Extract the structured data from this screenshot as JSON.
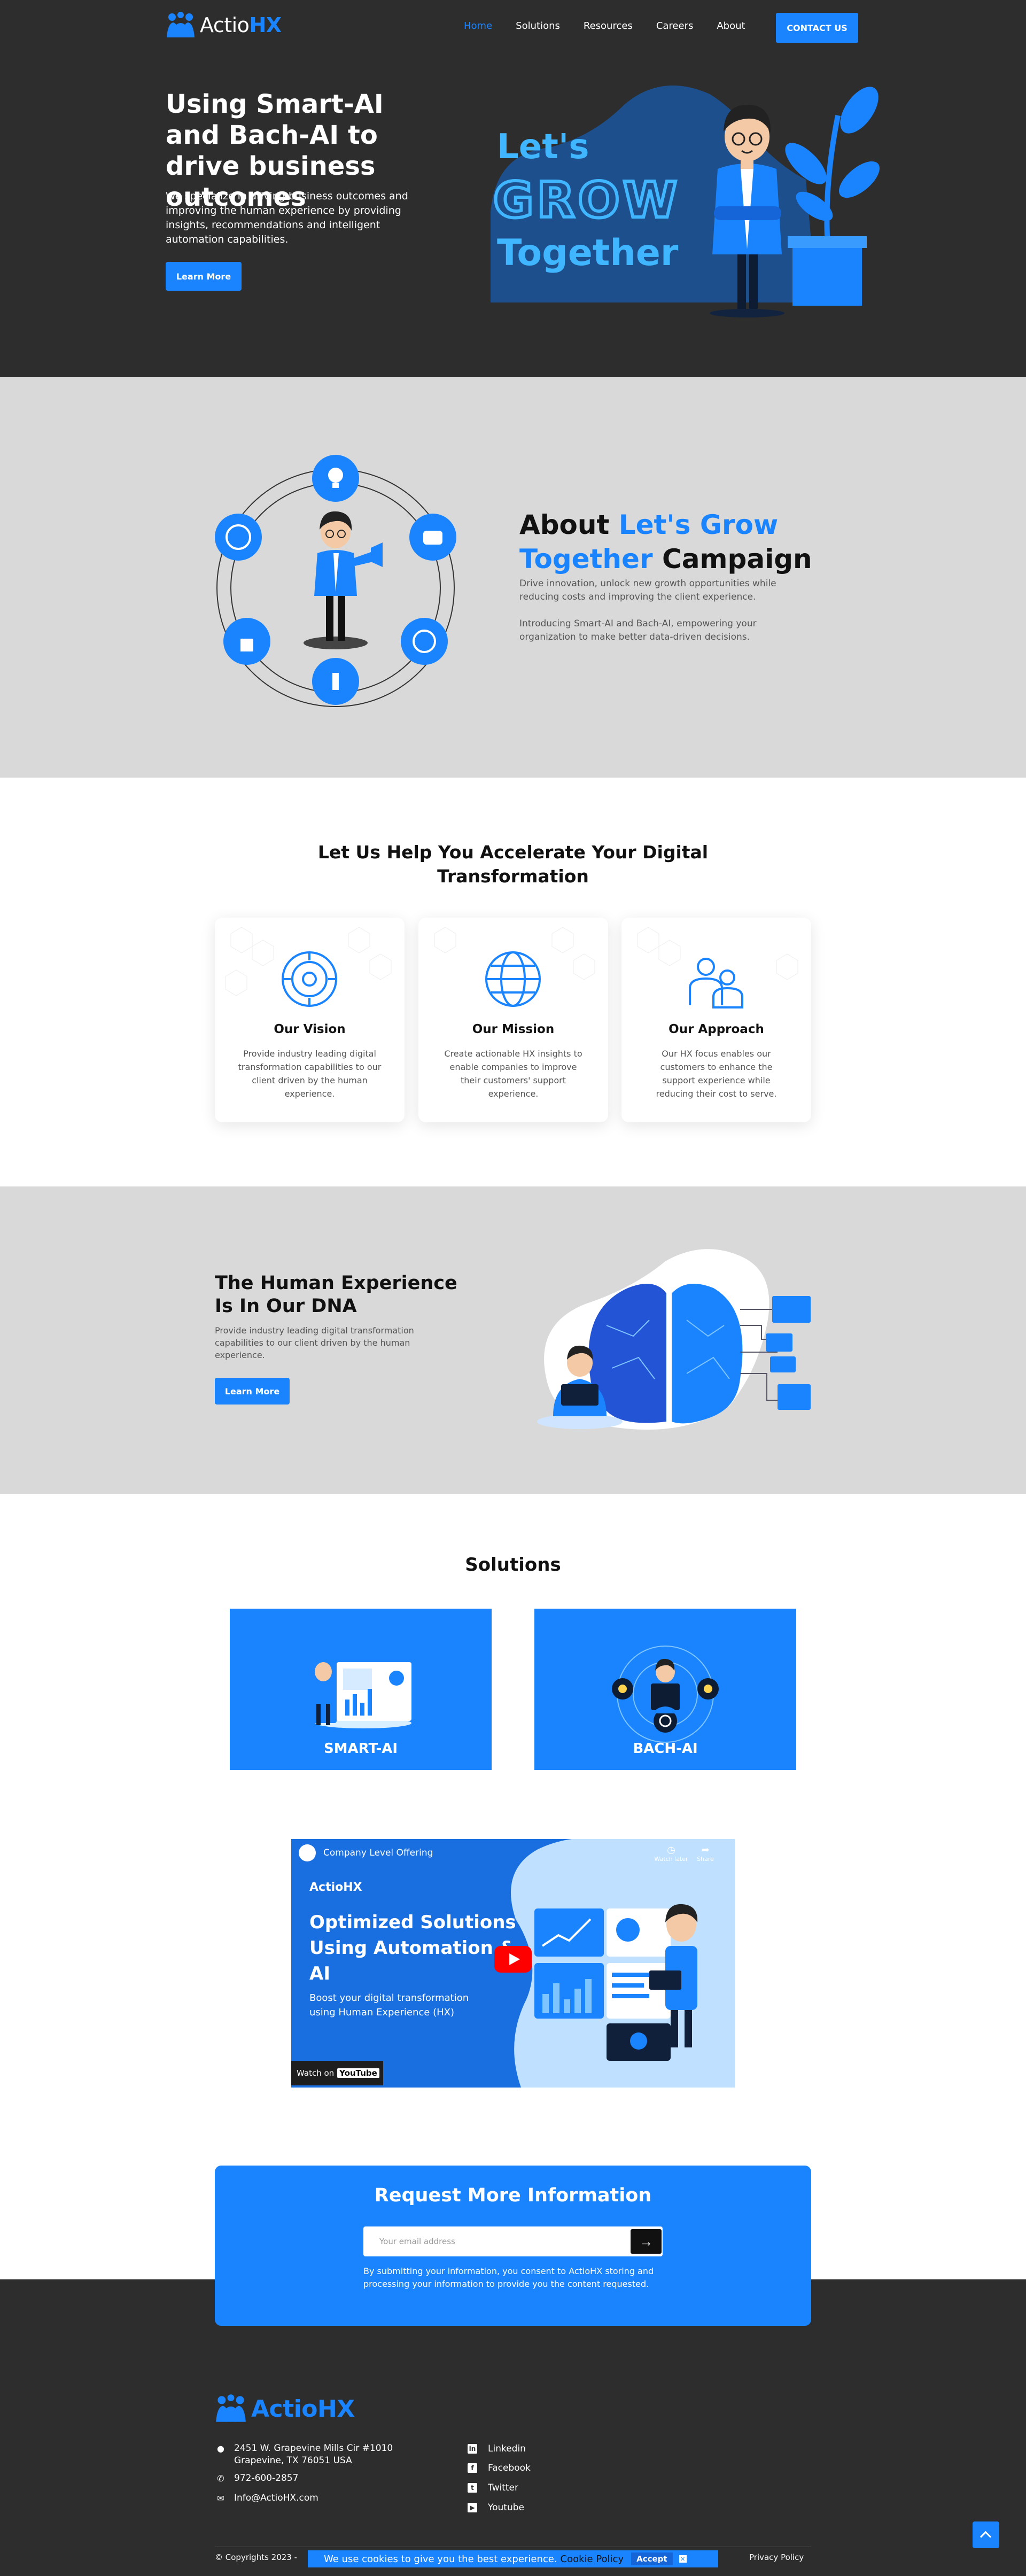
{
  "brand": {
    "name_pre": "Actio",
    "name_accent": "HX"
  },
  "nav": {
    "items": [
      "Home",
      "Solutions",
      "Resources",
      "Careers",
      "About"
    ],
    "contact_label": "CONTACT US"
  },
  "hero": {
    "title": "Using Smart-AI and Bach-AI to drive business outcomes",
    "description": "We specialize in driving business outcomes and improving the human experience by providing insights, recommendations and intelligent automation capabilities.",
    "button_label": "Learn More",
    "art_lines": [
      "Let's",
      "GROW",
      "Together"
    ]
  },
  "about": {
    "title_pre": "About ",
    "title_accent": "Let's Grow Together",
    "title_post": " Campaign",
    "paragraph1": "Drive innovation, unlock new growth opportunities while reducing costs and improving the client experience.",
    "paragraph2": "Introducing Smart-AI and Bach-AI, empowering your organization to make better data-driven decisions."
  },
  "accelerate": {
    "title": "Let Us Help You Accelerate Your Digital Transformation",
    "cards": [
      {
        "title": "Our Vision",
        "text": "Provide industry leading digital transformation capabilities to our client driven by the human experience.",
        "icon": "target-icon"
      },
      {
        "title": "Our Mission",
        "text": "Create actionable HX insights to enable companies to improve their customers' support experience.",
        "icon": "globe-icon"
      },
      {
        "title": "Our Approach",
        "text": "Our HX focus enables our customers to enhance the support experience while reducing their cost to serve.",
        "icon": "people-icon"
      }
    ]
  },
  "human_experience": {
    "title": "The Human Experience Is In Our DNA",
    "description": "Provide industry leading digital transformation capabilities to our client driven by the human experience.",
    "button_label": "Learn More"
  },
  "solutions": {
    "title": "Solutions",
    "items": [
      {
        "label": "SMART-AI"
      },
      {
        "label": "BACH-AI"
      }
    ]
  },
  "video": {
    "channel_title": "Company Level Offering",
    "watch_later": "Watch later",
    "share": "Share",
    "headline": "Optimized Solutions Using Automation & AI",
    "subtext": "Boost your digital transformation using Human Experience (HX)",
    "watch_on": "Watch on",
    "platform": "YouTube"
  },
  "request": {
    "title": "Request More Information",
    "email_placeholder": "Your email address",
    "note": "By submitting your information, you consent to ActioHX storing and processing your information to provide you the content requested."
  },
  "footer": {
    "address_line1": "2451 W. Grapevine Mills Cir #1010",
    "address_line2": "Grapevine, TX 76051 USA",
    "phone": "972-600-2857",
    "email": "Info@ActioHX.com",
    "social": [
      "Linkedin",
      "Facebook",
      "Twitter",
      "Youtube"
    ],
    "copyright": "© Copyrights 2023 -",
    "privacy": "Privacy Policy"
  },
  "cookie": {
    "text": "We use cookies to give you the best experience.",
    "policy_link": "Cookie Policy",
    "accept_label": "Accept"
  },
  "colors": {
    "accent": "#1a84ff",
    "dark": "#2d2d2d",
    "gray": "#d9d9d9"
  }
}
